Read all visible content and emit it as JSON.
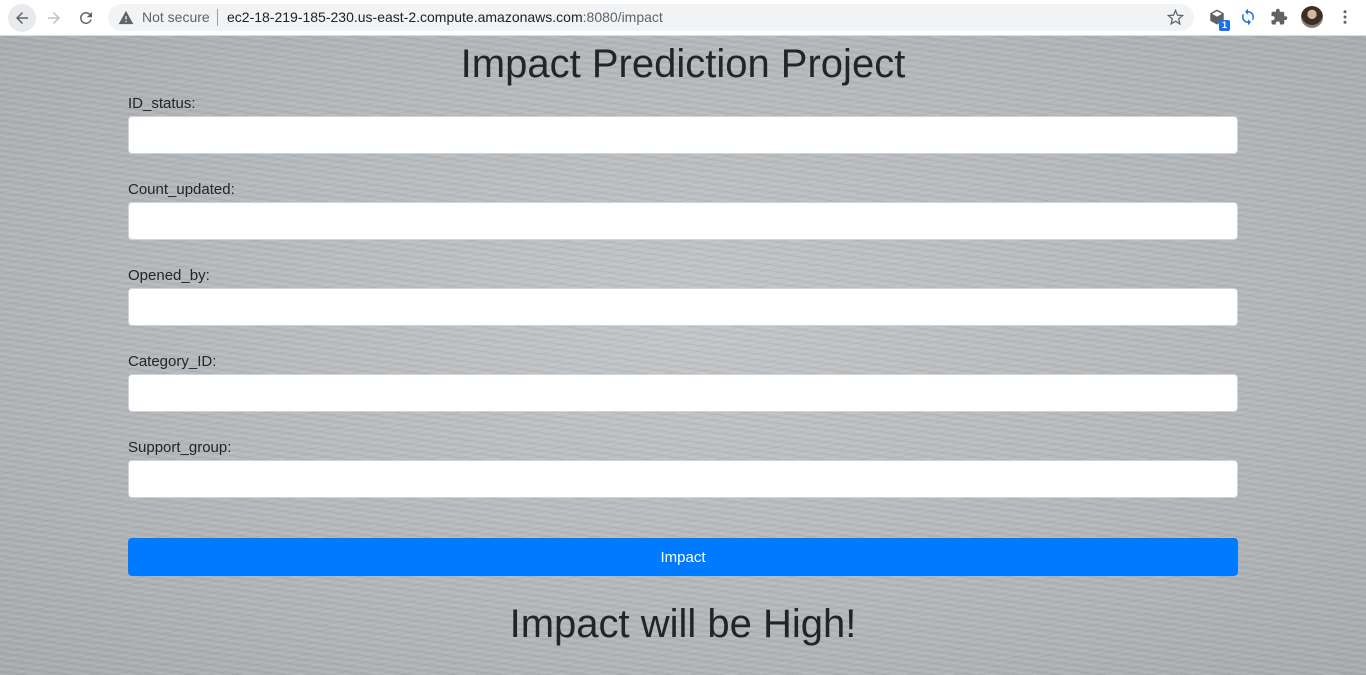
{
  "browser": {
    "security_label": "Not secure",
    "url_host": "ec2-18-219-185-230.us-east-2.compute.amazonaws.com",
    "url_rest": ":8080/impact",
    "extension_badge": "1"
  },
  "page": {
    "title": "Impact Prediction Project",
    "fields": [
      {
        "label": "ID_status:",
        "value": ""
      },
      {
        "label": "Count_updated:",
        "value": ""
      },
      {
        "label": "Opened_by:",
        "value": ""
      },
      {
        "label": "Category_ID:",
        "value": ""
      },
      {
        "label": "Support_group:",
        "value": ""
      }
    ],
    "submit_label": "Impact",
    "result_text": "Impact will be High!"
  },
  "colors": {
    "primary_button": "#007bff",
    "text": "#212529"
  }
}
